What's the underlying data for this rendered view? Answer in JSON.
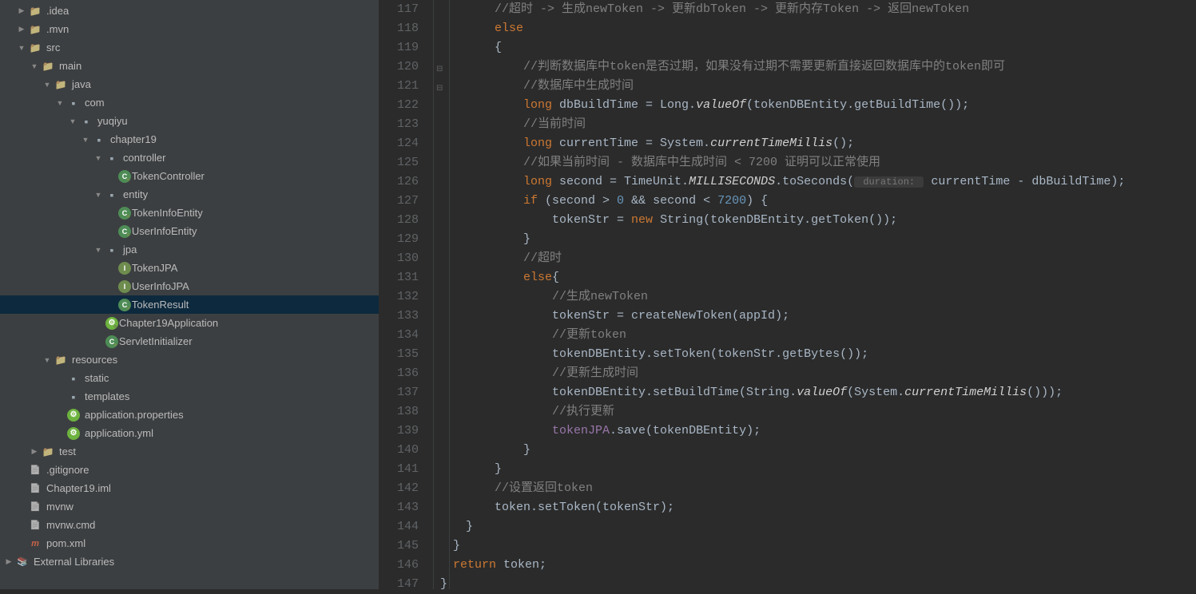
{
  "tree": [
    {
      "indent": 1,
      "arrow": "closed",
      "icon": "folder",
      "label": ".idea"
    },
    {
      "indent": 1,
      "arrow": "closed",
      "icon": "folder",
      "label": ".mvn"
    },
    {
      "indent": 1,
      "arrow": "open",
      "icon": "folder",
      "label": "src"
    },
    {
      "indent": 2,
      "arrow": "open",
      "icon": "folder",
      "label": "main"
    },
    {
      "indent": 3,
      "arrow": "open",
      "icon": "folder",
      "label": "java"
    },
    {
      "indent": 4,
      "arrow": "open",
      "icon": "package",
      "label": "com"
    },
    {
      "indent": 5,
      "arrow": "open",
      "icon": "package",
      "label": "yuqiyu"
    },
    {
      "indent": 6,
      "arrow": "open",
      "icon": "package",
      "label": "chapter19"
    },
    {
      "indent": 7,
      "arrow": "open",
      "icon": "package",
      "label": "controller"
    },
    {
      "indent": 8,
      "arrow": "none",
      "icon": "class",
      "vcs": true,
      "label": "TokenController"
    },
    {
      "indent": 7,
      "arrow": "open",
      "icon": "package",
      "label": "entity"
    },
    {
      "indent": 8,
      "arrow": "none",
      "icon": "class",
      "vcs": true,
      "label": "TokenInfoEntity"
    },
    {
      "indent": 8,
      "arrow": "none",
      "icon": "class",
      "vcs": true,
      "label": "UserInfoEntity"
    },
    {
      "indent": 7,
      "arrow": "open",
      "icon": "package",
      "label": "jpa"
    },
    {
      "indent": 8,
      "arrow": "none",
      "icon": "iface",
      "vcs": true,
      "label": "TokenJPA"
    },
    {
      "indent": 8,
      "arrow": "none",
      "icon": "iface",
      "vcs": true,
      "label": "UserInfoJPA"
    },
    {
      "indent": 8,
      "arrow": "none",
      "icon": "class",
      "vcs": true,
      "label": "TokenResult",
      "selected": true
    },
    {
      "indent": 7,
      "arrow": "none",
      "icon": "spring",
      "vcs": true,
      "label": "Chapter19Application"
    },
    {
      "indent": 7,
      "arrow": "none",
      "icon": "class",
      "vcs": true,
      "label": "ServletInitializer"
    },
    {
      "indent": 3,
      "arrow": "open",
      "icon": "folder",
      "label": "resources"
    },
    {
      "indent": 4,
      "arrow": "none",
      "icon": "package",
      "label": "static"
    },
    {
      "indent": 4,
      "arrow": "none",
      "icon": "package",
      "label": "templates"
    },
    {
      "indent": 4,
      "arrow": "none",
      "icon": "spring",
      "label": "application.properties"
    },
    {
      "indent": 4,
      "arrow": "none",
      "icon": "spring",
      "label": "application.yml"
    },
    {
      "indent": 2,
      "arrow": "closed",
      "icon": "folder",
      "label": "test"
    },
    {
      "indent": 1,
      "arrow": "none",
      "icon": "file",
      "label": ".gitignore"
    },
    {
      "indent": 1,
      "arrow": "none",
      "icon": "file",
      "label": "Chapter19.iml"
    },
    {
      "indent": 1,
      "arrow": "none",
      "icon": "file",
      "label": "mvnw"
    },
    {
      "indent": 1,
      "arrow": "none",
      "icon": "file",
      "label": "mvnw.cmd"
    },
    {
      "indent": 1,
      "arrow": "none",
      "icon": "xml",
      "label": "pom.xml"
    },
    {
      "indent": 0,
      "arrow": "closed",
      "icon": "lib",
      "label": "External Libraries"
    }
  ],
  "editor": {
    "startLine": 117,
    "lines": [
      {
        "n": 117,
        "tokens": [
          {
            "t": "    ",
            "c": ""
          },
          {
            "t": "//超时 -> 生成newToken -> 更新dbToken -> 更新内存Token -> 返回newToken",
            "c": "c-comment"
          }
        ]
      },
      {
        "n": 118,
        "tokens": [
          {
            "t": "    ",
            "c": ""
          },
          {
            "t": "else",
            "c": "c-keyword"
          }
        ]
      },
      {
        "n": 119,
        "tokens": [
          {
            "t": "    {",
            "c": ""
          }
        ]
      },
      {
        "n": 120,
        "fold": "open",
        "tokens": [
          {
            "t": "        ",
            "c": ""
          },
          {
            "t": "//判断数据库中token是否过期，如果没有过期不需要更新直接返回数据库中的token即可",
            "c": "c-comment"
          }
        ]
      },
      {
        "n": 121,
        "fold": "close",
        "tokens": [
          {
            "t": "        ",
            "c": ""
          },
          {
            "t": "//数据库中生成时间",
            "c": "c-comment"
          }
        ]
      },
      {
        "n": 122,
        "tokens": [
          {
            "t": "        ",
            "c": ""
          },
          {
            "t": "long ",
            "c": "c-keyword"
          },
          {
            "t": "dbBuildTime = Long.",
            "c": ""
          },
          {
            "t": "valueOf",
            "c": "c-static-i"
          },
          {
            "t": "(tokenDBEntity.getBuildTime());",
            "c": ""
          }
        ]
      },
      {
        "n": 123,
        "tokens": [
          {
            "t": "        ",
            "c": ""
          },
          {
            "t": "//当前时间",
            "c": "c-comment"
          }
        ]
      },
      {
        "n": 124,
        "tokens": [
          {
            "t": "        ",
            "c": ""
          },
          {
            "t": "long ",
            "c": "c-keyword"
          },
          {
            "t": "currentTime = System.",
            "c": ""
          },
          {
            "t": "currentTimeMillis",
            "c": "c-static-i"
          },
          {
            "t": "();",
            "c": ""
          }
        ]
      },
      {
        "n": 125,
        "tokens": [
          {
            "t": "        ",
            "c": ""
          },
          {
            "t": "//如果当前时间 - 数据库中生成时间 < 7200 证明可以正常使用",
            "c": "c-comment"
          }
        ]
      },
      {
        "n": 126,
        "tokens": [
          {
            "t": "        ",
            "c": ""
          },
          {
            "t": "long ",
            "c": "c-keyword"
          },
          {
            "t": "second = TimeUnit.",
            "c": ""
          },
          {
            "t": "MILLISECONDS",
            "c": "c-static-i"
          },
          {
            "t": ".toSeconds(",
            "c": ""
          },
          {
            "t": " duration: ",
            "c": "c-param-hint"
          },
          {
            "t": " currentTime - dbBuildTime);",
            "c": ""
          }
        ]
      },
      {
        "n": 127,
        "tokens": [
          {
            "t": "        ",
            "c": ""
          },
          {
            "t": "if ",
            "c": "c-keyword"
          },
          {
            "t": "(second > ",
            "c": ""
          },
          {
            "t": "0",
            "c": "c-number"
          },
          {
            "t": " && second < ",
            "c": ""
          },
          {
            "t": "7200",
            "c": "c-number"
          },
          {
            "t": ") {",
            "c": ""
          }
        ]
      },
      {
        "n": 128,
        "tokens": [
          {
            "t": "            tokenStr = ",
            "c": ""
          },
          {
            "t": "new ",
            "c": "c-keyword"
          },
          {
            "t": "String(tokenDBEntity.getToken());",
            "c": ""
          }
        ]
      },
      {
        "n": 129,
        "tokens": [
          {
            "t": "        }",
            "c": ""
          }
        ]
      },
      {
        "n": 130,
        "tokens": [
          {
            "t": "        ",
            "c": ""
          },
          {
            "t": "//超时",
            "c": "c-comment"
          }
        ]
      },
      {
        "n": 131,
        "tokens": [
          {
            "t": "        ",
            "c": ""
          },
          {
            "t": "else",
            "c": "c-keyword"
          },
          {
            "t": "{",
            "c": ""
          }
        ]
      },
      {
        "n": 132,
        "tokens": [
          {
            "t": "            ",
            "c": ""
          },
          {
            "t": "//生成newToken",
            "c": "c-comment"
          }
        ]
      },
      {
        "n": 133,
        "tokens": [
          {
            "t": "            tokenStr = createNewToken(appId);",
            "c": ""
          }
        ]
      },
      {
        "n": 134,
        "tokens": [
          {
            "t": "            ",
            "c": ""
          },
          {
            "t": "//更新token",
            "c": "c-comment"
          }
        ]
      },
      {
        "n": 135,
        "tokens": [
          {
            "t": "            tokenDBEntity.setToken(tokenStr.getBytes());",
            "c": ""
          }
        ]
      },
      {
        "n": 136,
        "tokens": [
          {
            "t": "            ",
            "c": ""
          },
          {
            "t": "//更新生成时间",
            "c": "c-comment"
          }
        ]
      },
      {
        "n": 137,
        "tokens": [
          {
            "t": "            tokenDBEntity.setBuildTime(String.",
            "c": ""
          },
          {
            "t": "valueOf",
            "c": "c-static-i"
          },
          {
            "t": "(System.",
            "c": ""
          },
          {
            "t": "currentTimeMillis",
            "c": "c-static-i"
          },
          {
            "t": "()));",
            "c": ""
          }
        ]
      },
      {
        "n": 138,
        "tokens": [
          {
            "t": "            ",
            "c": ""
          },
          {
            "t": "//执行更新",
            "c": "c-comment"
          }
        ]
      },
      {
        "n": 139,
        "tokens": [
          {
            "t": "            ",
            "c": ""
          },
          {
            "t": "tokenJPA",
            "c": "c-field"
          },
          {
            "t": ".save(tokenDBEntity);",
            "c": ""
          }
        ]
      },
      {
        "n": 140,
        "tokens": [
          {
            "t": "        }",
            "c": ""
          }
        ]
      },
      {
        "n": 141,
        "tokens": [
          {
            "t": "    }",
            "c": ""
          }
        ]
      },
      {
        "n": 142,
        "tokens": [
          {
            "t": "    ",
            "c": ""
          },
          {
            "t": "//设置返回token",
            "c": "c-comment"
          }
        ]
      },
      {
        "n": 143,
        "tokens": [
          {
            "t": "    token.setToken(tokenStr);",
            "c": ""
          }
        ]
      },
      {
        "n": 144,
        "tokens": [
          {
            "t": "}",
            "c": ""
          }
        ]
      },
      {
        "n": 145,
        "tokens": [
          {
            "t": "}",
            "c": ""
          }
        ],
        "outdent": 1
      },
      {
        "n": 146,
        "tokens": [
          {
            "t": "return ",
            "c": "c-keyword"
          },
          {
            "t": "token;",
            "c": ""
          }
        ],
        "outdent": 1
      },
      {
        "n": 147,
        "tokens": [
          {
            "t": "}",
            "c": ""
          }
        ],
        "outdent": 2
      }
    ]
  }
}
